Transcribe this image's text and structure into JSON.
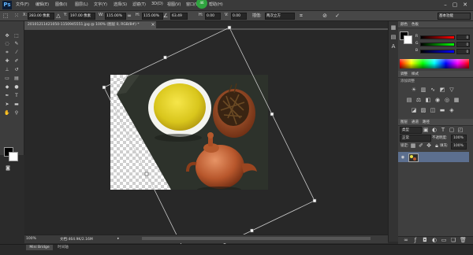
{
  "app": {
    "logo": "Ps"
  },
  "menubar": {
    "items": [
      "文件(F)",
      "编辑(E)",
      "图像(I)",
      "图层(L)",
      "文字(Y)",
      "选择(S)",
      "滤镜(T)",
      "3D(D)",
      "视图(V)",
      "窗口(W)",
      "帮助(H)"
    ],
    "badge": "46",
    "window_controls": [
      "–",
      "▢",
      "✕"
    ]
  },
  "options_bar": {
    "x_label": "X:",
    "x_value": "283.00 像素",
    "y_label": "Y:",
    "y_value": "197.00 像素",
    "w_label": "W:",
    "w_value": "115.00%",
    "h_label": "H:",
    "h_value": "115.00%",
    "angle_value": "63.49",
    "skew_h_label": "H:",
    "skew_h_value": "0.00",
    "skew_v_label": "V:",
    "skew_v_value": "0.00",
    "interp_label": "插值:",
    "interp_value": "两次立方",
    "workspace": "基本功能"
  },
  "document": {
    "tab_title": "20101211421050-1150945551.jpg @ 100% (图层 0, RGB/8#) *",
    "zoom": "100%",
    "doc_info": "文档:464.9K/2.16M"
  },
  "minibridge": {
    "tab1": "Mini Bridge",
    "tab2": "时间轴"
  },
  "panels": {
    "color": {
      "tab1": "颜色",
      "tab2": "色板",
      "r": "R",
      "g": "G",
      "b": "B",
      "r_val": "0",
      "g_val": "0",
      "b_val": "0"
    },
    "adjustments": {
      "tab1": "调整",
      "tab2": "样式",
      "title": "添加调整"
    },
    "layers": {
      "tab1": "图层",
      "tab2": "通道",
      "tab3": "路径",
      "kind": "类型",
      "blend_mode": "正常",
      "opacity_label": "不透明度:",
      "opacity_value": "100%",
      "lock_label": "锁定:",
      "fill_label": "填充:",
      "fill_value": "100%",
      "layer_name": "图层 0"
    }
  },
  "colors": {
    "accent_selection": "#5c6f8f",
    "foreground": "#000000",
    "background": "#ffffff"
  }
}
